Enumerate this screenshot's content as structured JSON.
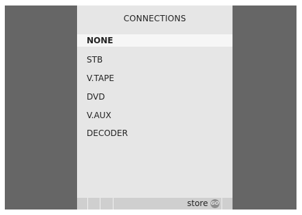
{
  "menu": {
    "title": "CONNECTIONS",
    "items": [
      {
        "label": "NONE",
        "selected": true
      },
      {
        "label": "STB",
        "selected": false
      },
      {
        "label": "V.TAPE",
        "selected": false
      },
      {
        "label": "DVD",
        "selected": false
      },
      {
        "label": "V.AUX",
        "selected": false
      },
      {
        "label": "DECODER",
        "selected": false
      }
    ]
  },
  "footer": {
    "store_label": "store",
    "go_icon": "GO"
  },
  "colors": {
    "background": "#666666",
    "panel": "#e6e6e6",
    "selected_row": "#f6f6f6",
    "footer_bar": "#cfcfcf"
  }
}
